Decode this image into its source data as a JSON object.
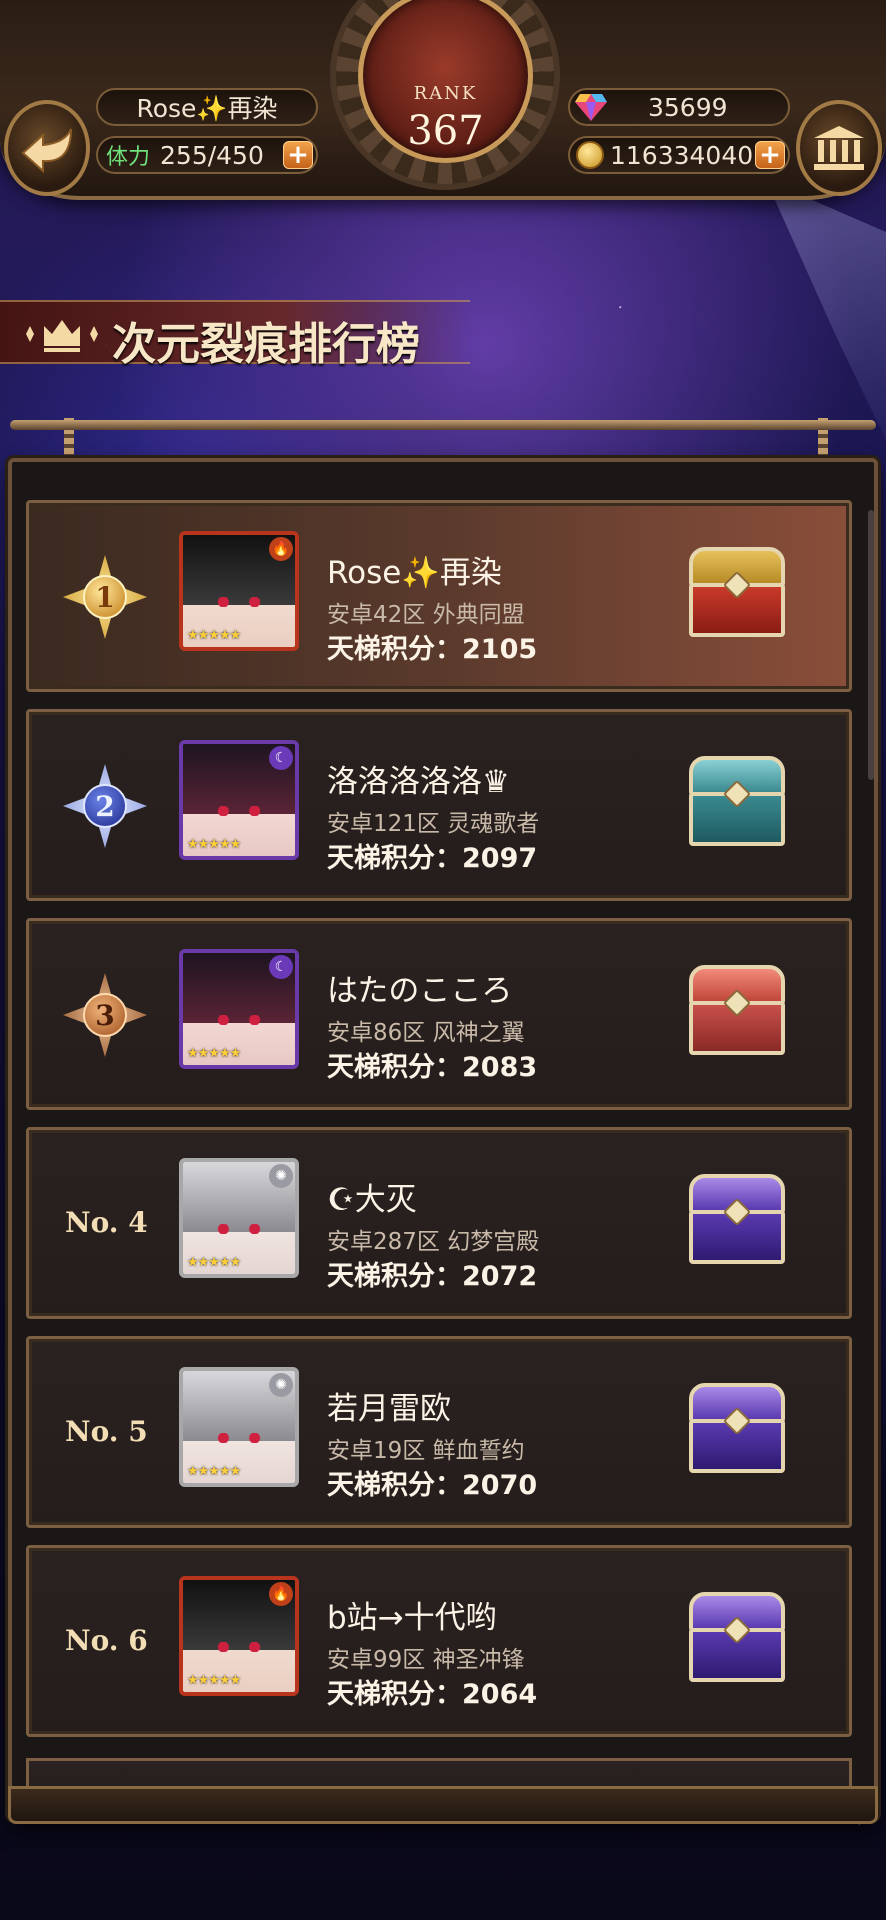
{
  "header": {
    "player_name": "Rose✨再染",
    "stamina_label": "体力",
    "stamina_value": "255/450",
    "rank_label": "RANK",
    "rank_value": "367",
    "gems": "35699",
    "gold": "116334040",
    "plus_symbol": "+"
  },
  "title": "次元裂痕排行榜",
  "leaderboard": [
    {
      "rank": "1",
      "name": "Rose✨再染",
      "server": "安卓42区 外典同盟",
      "score": "天梯积分：2105",
      "chest": "gold",
      "element": "fire"
    },
    {
      "rank": "2",
      "name": "洛洛洛洛洛♛",
      "server": "安卓121区 灵魂歌者",
      "score": "天梯积分：2097",
      "chest": "teal",
      "element": "moon"
    },
    {
      "rank": "3",
      "name": "はたのこころ",
      "server": "安卓86区 风神之翼",
      "score": "天梯积分：2083",
      "chest": "red",
      "element": "moon"
    },
    {
      "rank": "No. 4",
      "name": "☪大灭",
      "server": "安卓287区 幻梦宫殿",
      "score": "天梯积分：2072",
      "chest": "purple",
      "element": "light"
    },
    {
      "rank": "No. 5",
      "name": "若月雷欧",
      "server": "安卓19区 鲜血誓约",
      "score": "天梯积分：2070",
      "chest": "purple",
      "element": "light"
    },
    {
      "rank": "No. 6",
      "name": "b站→十代哟",
      "server": "安卓99区 神圣冲锋",
      "score": "天梯积分：2064",
      "chest": "purple",
      "element": "fire"
    }
  ],
  "colors": {
    "gold_chest": "#c9a030",
    "teal_chest": "#4a9aa0",
    "red_chest": "#c8504a",
    "purple_chest": "#6a4ab8",
    "frame": "#7c5f42"
  }
}
